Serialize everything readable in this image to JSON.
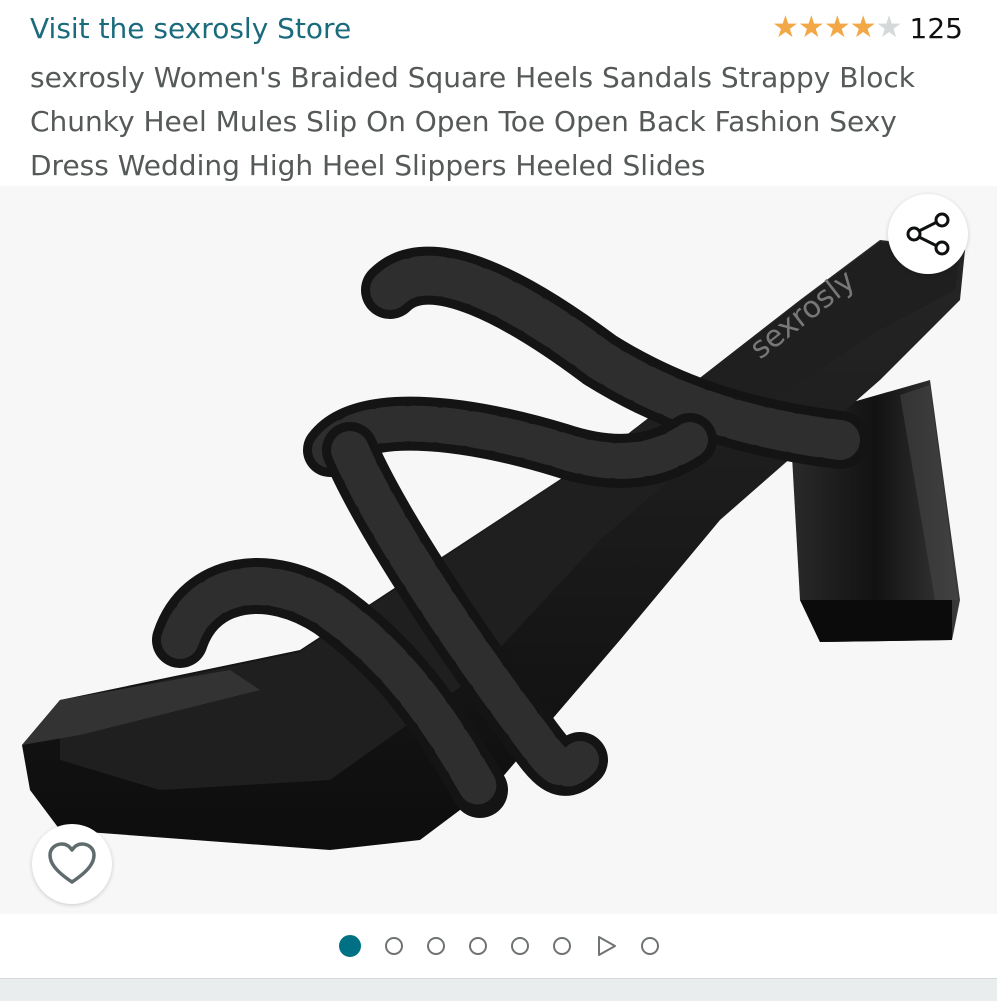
{
  "header": {
    "store_link": "Visit the sexrosly Store",
    "rating": {
      "value": 4,
      "max": 5,
      "count": "125",
      "star_color": "#f3a847"
    },
    "title": "sexrosly Women's Braided Square Heels Sandals Strappy Block Chunky Heel Mules Slip On Open Toe Open Back Fashion Sexy Dress Wedding High Heel Slippers Heeled Slides"
  },
  "gallery": {
    "image_icon": "black-braided-sandal-image",
    "insole_brand": "sexrosly",
    "share_icon": "share-icon",
    "wishlist_icon": "heart-icon",
    "pager": {
      "total_dots": 8,
      "active_index": 0,
      "video_index": 6,
      "active_color": "#007185"
    }
  },
  "colors": {
    "store_link": "#1a6b7c",
    "title": "#565959"
  }
}
